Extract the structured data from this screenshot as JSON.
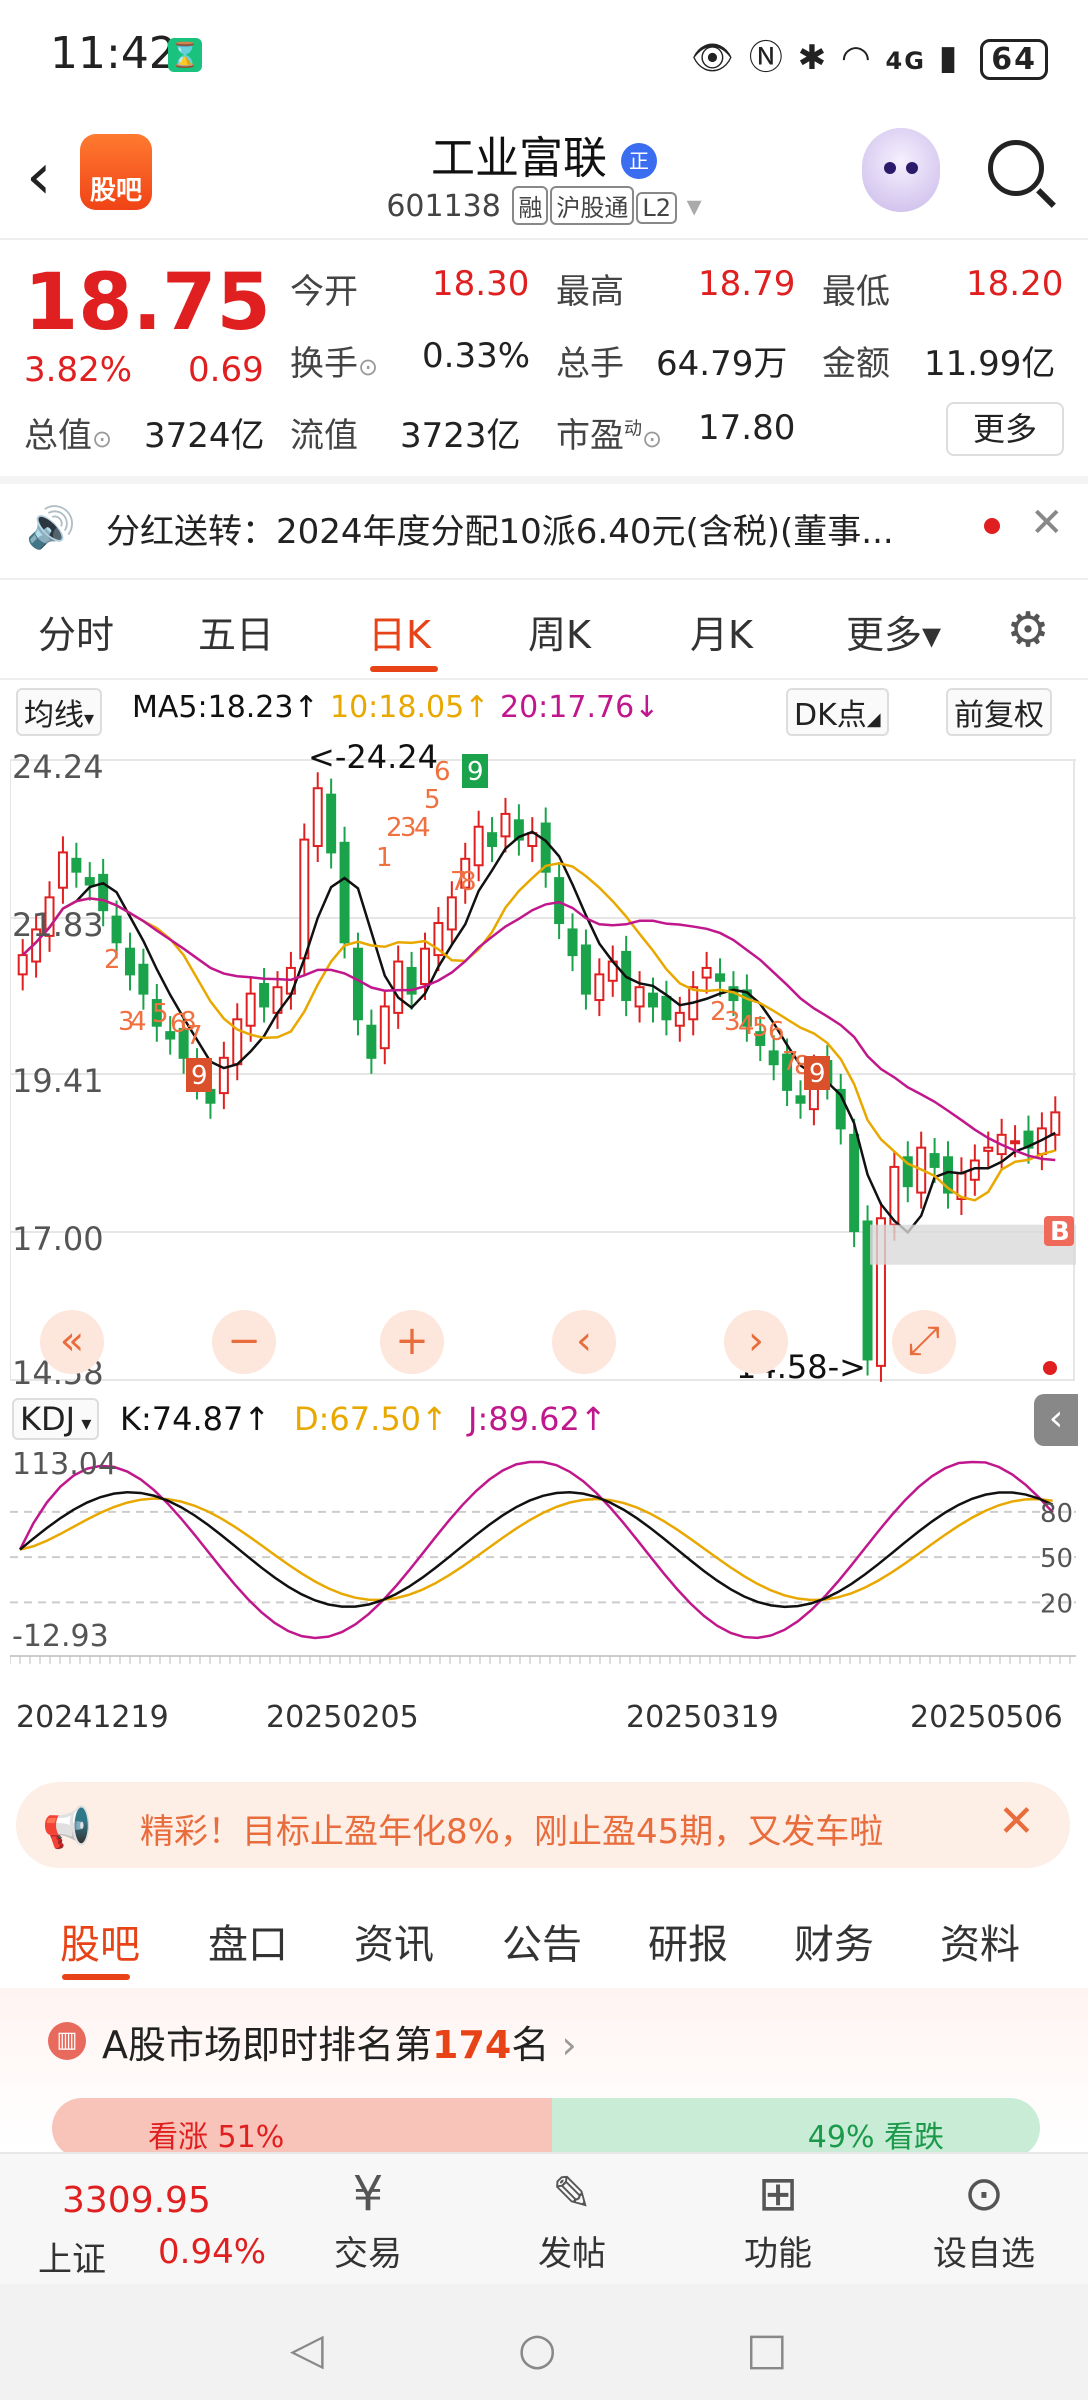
{
  "status": {
    "time": "11:42",
    "network": "4G",
    "battery": "64"
  },
  "header": {
    "logo_label": "股吧",
    "title": "工业富联",
    "badge": "正",
    "code": "601138",
    "tags": [
      "融",
      "沪股通",
      "L2"
    ]
  },
  "quote": {
    "price": "18.75",
    "pct": "3.82%",
    "change": "0.69",
    "open_label": "今开",
    "open": "18.30",
    "high_label": "最高",
    "high": "18.79",
    "low_label": "最低",
    "low": "18.20",
    "turnover_label": "换手",
    "turnover": "0.33%",
    "volume_label": "总手",
    "volume": "64.79万",
    "amount_label": "金额",
    "amount": "11.99亿",
    "mktcap_label": "总值",
    "mktcap": "3724亿",
    "float_label": "流值",
    "float_cap": "3723亿",
    "pe_label": "市盈",
    "pe_sup": "动",
    "pe": "17.80",
    "more": "更多"
  },
  "notice": {
    "text": "分红送转：2024年度分配10派6.40元(含税)(董事..."
  },
  "tabs": [
    "分时",
    "五日",
    "日K",
    "周K",
    "月K",
    "更多▾"
  ],
  "ma": {
    "selector": "均线",
    "ma5": "MA5:18.23↑",
    "ma10": "10:18.05↑",
    "ma20": "20:17.76↓",
    "dk": "DK点",
    "adjust": "前复权"
  },
  "chart_data": [
    {
      "type": "candlestick",
      "title": "",
      "y_ticks": [
        "24.24",
        "21.83",
        "19.41",
        "17.00",
        "14.58"
      ],
      "ylim": [
        14.58,
        24.24
      ],
      "annotations": [
        "<-24.24",
        "14.58->",
        "B"
      ],
      "td_counts_top": [
        "1",
        "2",
        "3",
        "4",
        "5",
        "6",
        "7",
        "8",
        "9"
      ],
      "td_counts_bottom": [
        "2",
        "3",
        "4",
        "5",
        "6",
        "7",
        "8",
        "9"
      ],
      "closes": [
        21.2,
        21.6,
        22.1,
        22.8,
        22.5,
        22.3,
        21.9,
        21.4,
        20.9,
        20.6,
        20.1,
        19.9,
        19.6,
        19.2,
        18.9,
        19.6,
        20.2,
        20.6,
        20.4,
        20.7,
        21.0,
        23.0,
        23.8,
        22.8,
        21.4,
        20.2,
        19.6,
        20.4,
        21.1,
        20.6,
        21.3,
        21.7,
        22.1,
        22.7,
        23.2,
        22.9,
        23.4,
        23.0,
        23.1,
        22.5,
        21.7,
        21.2,
        20.6,
        20.9,
        21.1,
        20.5,
        20.7,
        20.4,
        20.2,
        20.3,
        20.7,
        21.0,
        20.8,
        20.5,
        20.1,
        19.8,
        19.5,
        19.1,
        18.9,
        19.4,
        19.2,
        18.5,
        16.9,
        14.9,
        17.1,
        17.9,
        17.6,
        18.2,
        17.9,
        17.5,
        17.8,
        18.0,
        18.2,
        18.4,
        18.3,
        18.2,
        18.5,
        18.75
      ],
      "series": [
        {
          "name": "MA5",
          "color": "#111111"
        },
        {
          "name": "MA10",
          "color": "#e9a800"
        },
        {
          "name": "MA20",
          "color": "#c0178c"
        }
      ],
      "control_icons": [
        "double-left",
        "minus",
        "plus",
        "left",
        "right",
        "expand"
      ]
    },
    {
      "type": "line",
      "title": "",
      "y_ticks": [
        "113.04",
        "-12.93"
      ],
      "ylim": [
        -12.93,
        113.04
      ],
      "right_ticks": [
        "80",
        "50",
        "20"
      ],
      "legend": {
        "selector": "KDJ",
        "k": "K:74.87↑",
        "d": "D:67.50↑",
        "j": "J:89.62↑"
      },
      "x_labels": [
        "20241219",
        "20250205",
        "20250319",
        "20250506"
      ],
      "series": [
        {
          "name": "K",
          "color": "#111111"
        },
        {
          "name": "D",
          "color": "#e9a800"
        },
        {
          "name": "J",
          "color": "#c0178c"
        }
      ]
    }
  ],
  "promo": {
    "text": "精彩！目标止盈年化8%，刚止盈45期，又发车啦"
  },
  "section_tabs": [
    "股吧",
    "盘口",
    "资讯",
    "公告",
    "研报",
    "财务",
    "资料"
  ],
  "rank": {
    "prefix": "A股市场即时排名第",
    "num": "174",
    "suffix": "名"
  },
  "vote": {
    "up": "看涨 51%",
    "down": "49% 看跌"
  },
  "bottom": {
    "index_value": "3309.95",
    "index_name": "上证",
    "index_pct": "0.94%",
    "nav": [
      "交易",
      "发帖",
      "功能",
      "设自选"
    ]
  }
}
